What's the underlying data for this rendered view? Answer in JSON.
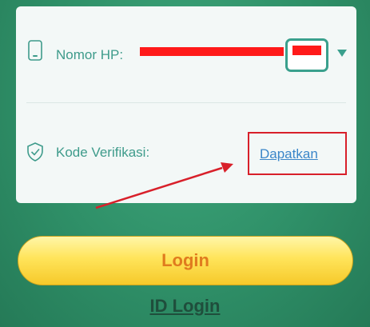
{
  "form": {
    "phone_label": "Nomor HP:",
    "phone_value_redacted": true,
    "country_flag": "indonesia-flag",
    "code_label": "Kode Verifikasi:",
    "get_code_label": "Dapatkan"
  },
  "icons": {
    "phone": "phone-icon",
    "shield": "shield-check-icon",
    "caret": "chevron-down-icon"
  },
  "actions": {
    "login_label": "Login",
    "id_login_label": "ID Login"
  },
  "colors": {
    "accent": "#3aa08d",
    "link": "#3a86c9",
    "annotation": "#d8202a",
    "button": "#ffe45a",
    "button_text": "#e07b1e"
  }
}
